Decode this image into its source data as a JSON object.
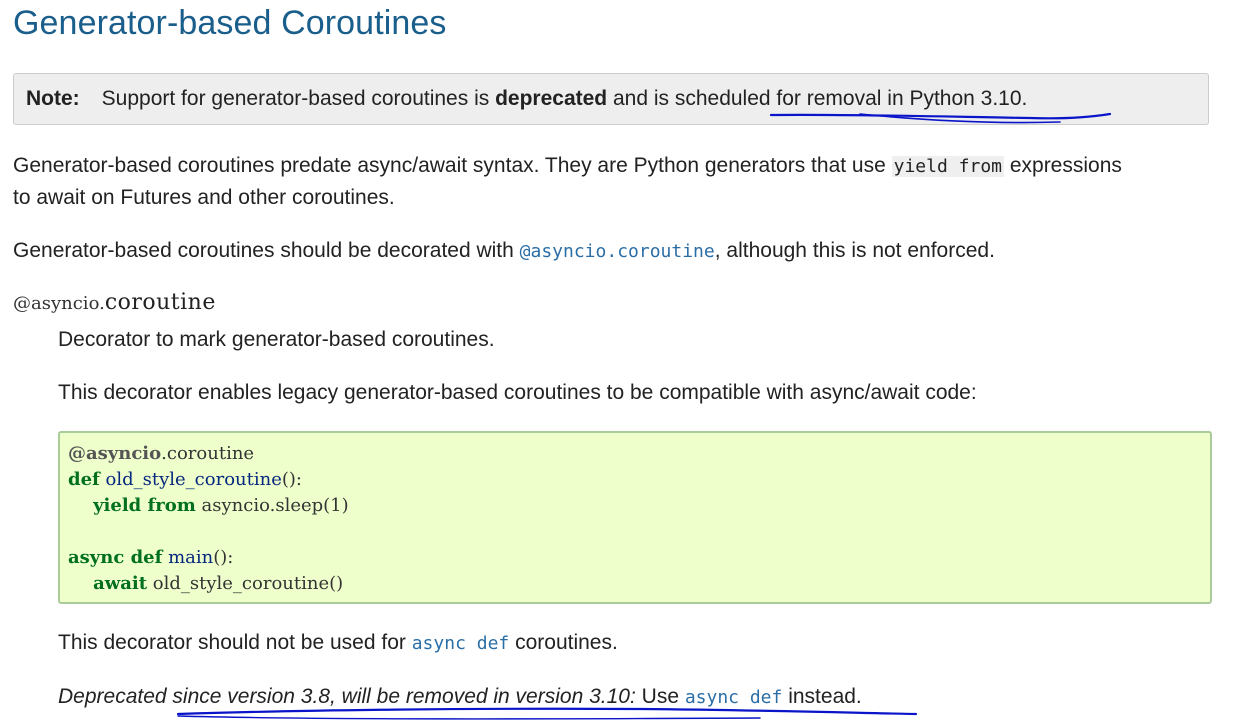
{
  "heading": "Generator-based Coroutines",
  "note": {
    "title": "Note:",
    "text_before": "Support for generator-based coroutines is ",
    "bold": "deprecated",
    "text_after": " and is scheduled for removal in Python 3.10."
  },
  "para1": {
    "text_before": "Generator-based coroutines predate async/await syntax. They are Python generators that use ",
    "code": "yield from",
    "text_after": " expressions",
    "line2": "to await on Futures and other coroutines."
  },
  "para2": {
    "text_before": "Generator-based coroutines should be decorated with ",
    "link": "@asyncio.coroutine",
    "text_after": ", although this is not enforced."
  },
  "signature": {
    "prefix": "@asyncio.",
    "name": "coroutine"
  },
  "description": {
    "line1": "Decorator to mark generator-based coroutines.",
    "line2": "This decorator enables legacy generator-based coroutines to be compatible with async/await code:"
  },
  "code_example": {
    "l1_deco": "@asyncio",
    "l1_rest": ".coroutine",
    "l2_kw": "def",
    "l2_fn": " old_style_coroutine",
    "l2_rest": "():",
    "l3_kw1": "    yield",
    "l3_kw2": " from",
    "l3_rest": " asyncio.sleep(1)",
    "l5_kw1": "async",
    "l5_kw2": " def",
    "l5_fn": " main",
    "l5_rest": "():",
    "l6_kw": "    await",
    "l6_rest": " old_style_coroutine()"
  },
  "para3": {
    "text_before": "This decorator should not be used for ",
    "link": "async def",
    "text_after": " coroutines."
  },
  "deprecated": {
    "emph": "Deprecated since version 3.8, will be removed in version 3.10:",
    "text_before": " Use ",
    "link": "async def",
    "text_after": " instead."
  },
  "colors": {
    "heading": "#1a5e8c",
    "link": "#2b6ea6",
    "annotation_ink": "#0a14c8",
    "code_bg": "#eeffcc"
  }
}
